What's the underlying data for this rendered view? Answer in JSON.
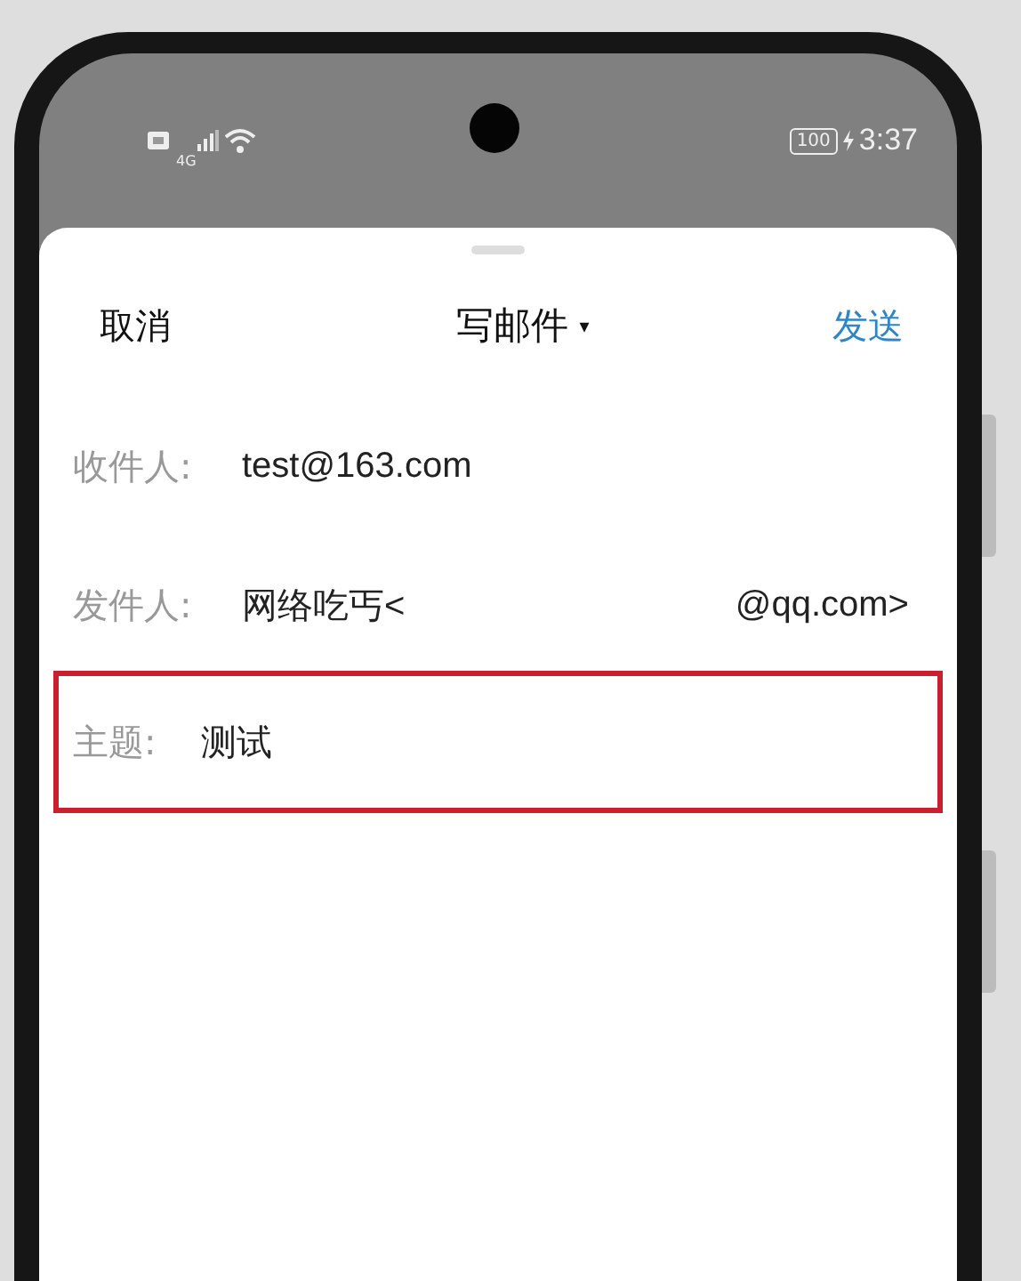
{
  "status_bar": {
    "signal_label": "4G",
    "battery": "100",
    "time": "3:37"
  },
  "header": {
    "cancel": "取消",
    "title": "写邮件",
    "title_caret": "▾",
    "send": "发送"
  },
  "fields": [
    {
      "kind": "to",
      "label": "收件人:",
      "value": "test@163.com",
      "highlighted": false
    },
    {
      "kind": "from",
      "label": "发件人:",
      "value": "网络吃丐<",
      "value_end": "@qq.com>",
      "highlighted": false
    },
    {
      "kind": "subject",
      "label": "主题:",
      "value": "测试",
      "highlighted": true
    }
  ]
}
